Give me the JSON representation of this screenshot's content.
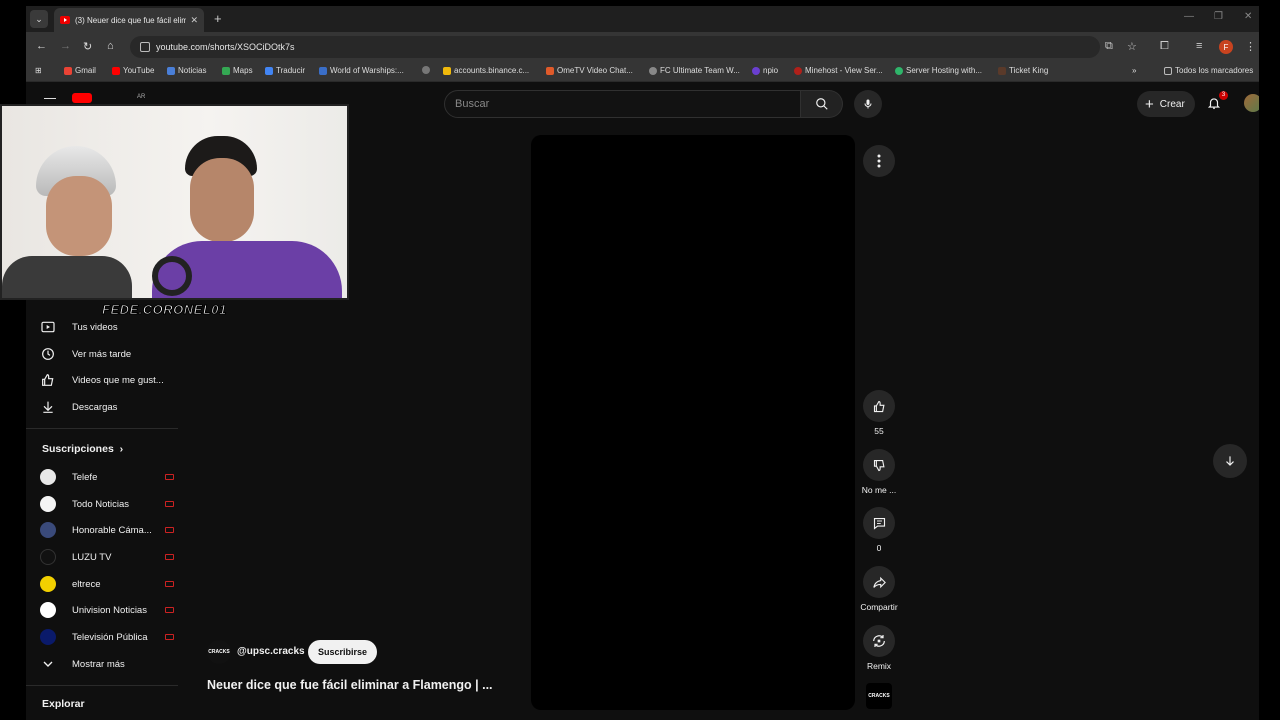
{
  "browser": {
    "tab_title": "(3) Neuer dice que fue fácil elimi",
    "url": "youtube.com/shorts/XSOCiDOtk7s",
    "bookmarks": [
      "Gmail",
      "YouTube",
      "Noticias",
      "Maps",
      "Traducir",
      "World of Warships:...",
      "accounts.binance.c...",
      "OmeTV Video Chat...",
      "FC Ultimate Team W...",
      "npio",
      "Minehost - View Ser...",
      "Server Hosting with...",
      "Ticket King"
    ],
    "all_bookmarks": "Todos los marcadores",
    "profile_initial": "F"
  },
  "youtube": {
    "country_code": "AR",
    "search_placeholder": "Buscar",
    "create_label": "Crear",
    "notif_count": "3",
    "sidebar": {
      "you_items": [
        "Tus videos",
        "Ver más tarde",
        "Videos que me gust...",
        "Descargas"
      ],
      "subs_title": "Suscripciones",
      "subscriptions": [
        {
          "name": "Telefe",
          "color": "#e8e8e8"
        },
        {
          "name": "Todo Noticias",
          "color": "#f4f4f4"
        },
        {
          "name": "Honorable Cáma...",
          "color": "#3a4a7a"
        },
        {
          "name": "LUZU TV",
          "color": "#111111"
        },
        {
          "name": "eltrece",
          "color": "#f2d000"
        },
        {
          "name": "Univision Noticias",
          "color": "#ffffff"
        },
        {
          "name": "Televisión Pública",
          "color": "#0a1a6a"
        }
      ],
      "show_more": "Mostrar más",
      "explore_title": "Explorar"
    },
    "short": {
      "channel": "@upsc.cracks",
      "channel_badge": "CRACKS",
      "subscribe_label": "Suscribirse",
      "title": "Neuer dice que fue fácil eliminar a Flamengo | ...",
      "likes": "55",
      "dislike_label": "No me ...",
      "comments": "0",
      "share_label": "Compartir",
      "remix_label": "Remix"
    }
  },
  "overlay": {
    "streamer_name": "FEDE.CORONEL01"
  }
}
